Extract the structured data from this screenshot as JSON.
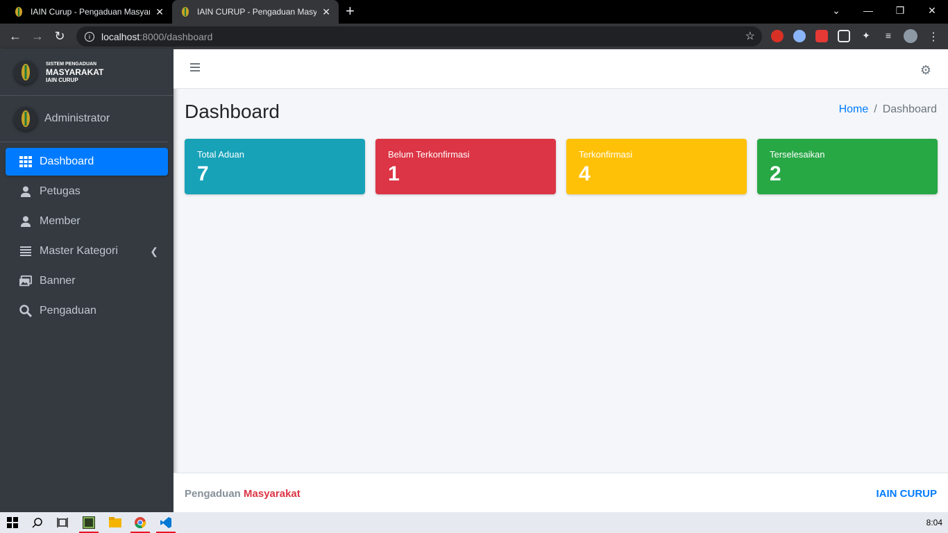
{
  "browser": {
    "tabs": [
      {
        "title": "IAIN Curup - Pengaduan Masyara"
      },
      {
        "title": "IAIN CURUP - Pengaduan Masyar"
      }
    ],
    "url_host": "localhost",
    "url_path": ":8000/dashboard"
  },
  "sidebar": {
    "brand_line1": "SISTEM PENGADUAN",
    "brand_line2": "MASYARAKAT",
    "brand_line3": "IAIN CURUP",
    "user_name": "Administrator",
    "items": [
      {
        "label": "Dashboard",
        "icon": "grid-icon",
        "active": true
      },
      {
        "label": "Petugas",
        "icon": "user-icon"
      },
      {
        "label": "Member",
        "icon": "user-icon"
      },
      {
        "label": "Master Kategori",
        "icon": "list-icon",
        "has_submenu": true
      },
      {
        "label": "Banner",
        "icon": "images-icon"
      },
      {
        "label": "Pengaduan",
        "icon": "search-icon"
      }
    ]
  },
  "header": {
    "page_title": "Dashboard",
    "breadcrumb_home": "Home",
    "breadcrumb_sep": "/",
    "breadcrumb_current": "Dashboard"
  },
  "cards": [
    {
      "label": "Total Aduan",
      "value": "7",
      "color": "#17a2b8"
    },
    {
      "label": "Belum Terkonfirmasi",
      "value": "1",
      "color": "#dc3545"
    },
    {
      "label": "Terkonfirmasi",
      "value": "4",
      "color": "#ffc107"
    },
    {
      "label": "Terselesaikan",
      "value": "2",
      "color": "#28a745"
    }
  ],
  "footer": {
    "left_a": "Pengaduan",
    "left_b": "Masyarakat",
    "right": "IAIN CURUP"
  },
  "taskbar": {
    "clock": "8:04"
  }
}
